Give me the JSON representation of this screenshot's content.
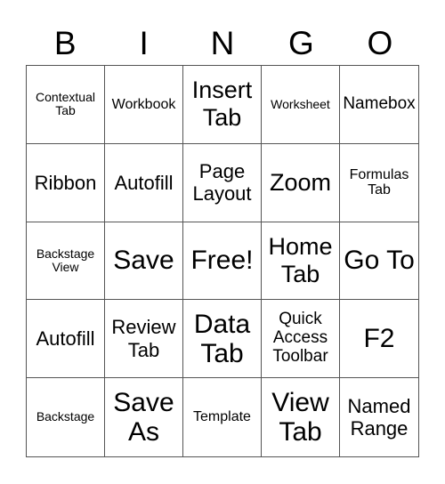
{
  "header": [
    "B",
    "I",
    "N",
    "G",
    "O"
  ],
  "cells": [
    "Contextual Tab",
    "Workbook",
    "Insert Tab",
    "Worksheet",
    "Namebox",
    "Ribbon",
    "Autofill",
    "Page Layout",
    "Zoom",
    "Formulas Tab",
    "Backstage View",
    "Save",
    "Free!",
    "Home Tab",
    "Go To",
    "Autofill",
    "Review Tab",
    "Data Tab",
    "Quick Access Toolbar",
    "F2",
    "Backstage",
    "Save As",
    "Template",
    "View Tab",
    "Named Range"
  ]
}
